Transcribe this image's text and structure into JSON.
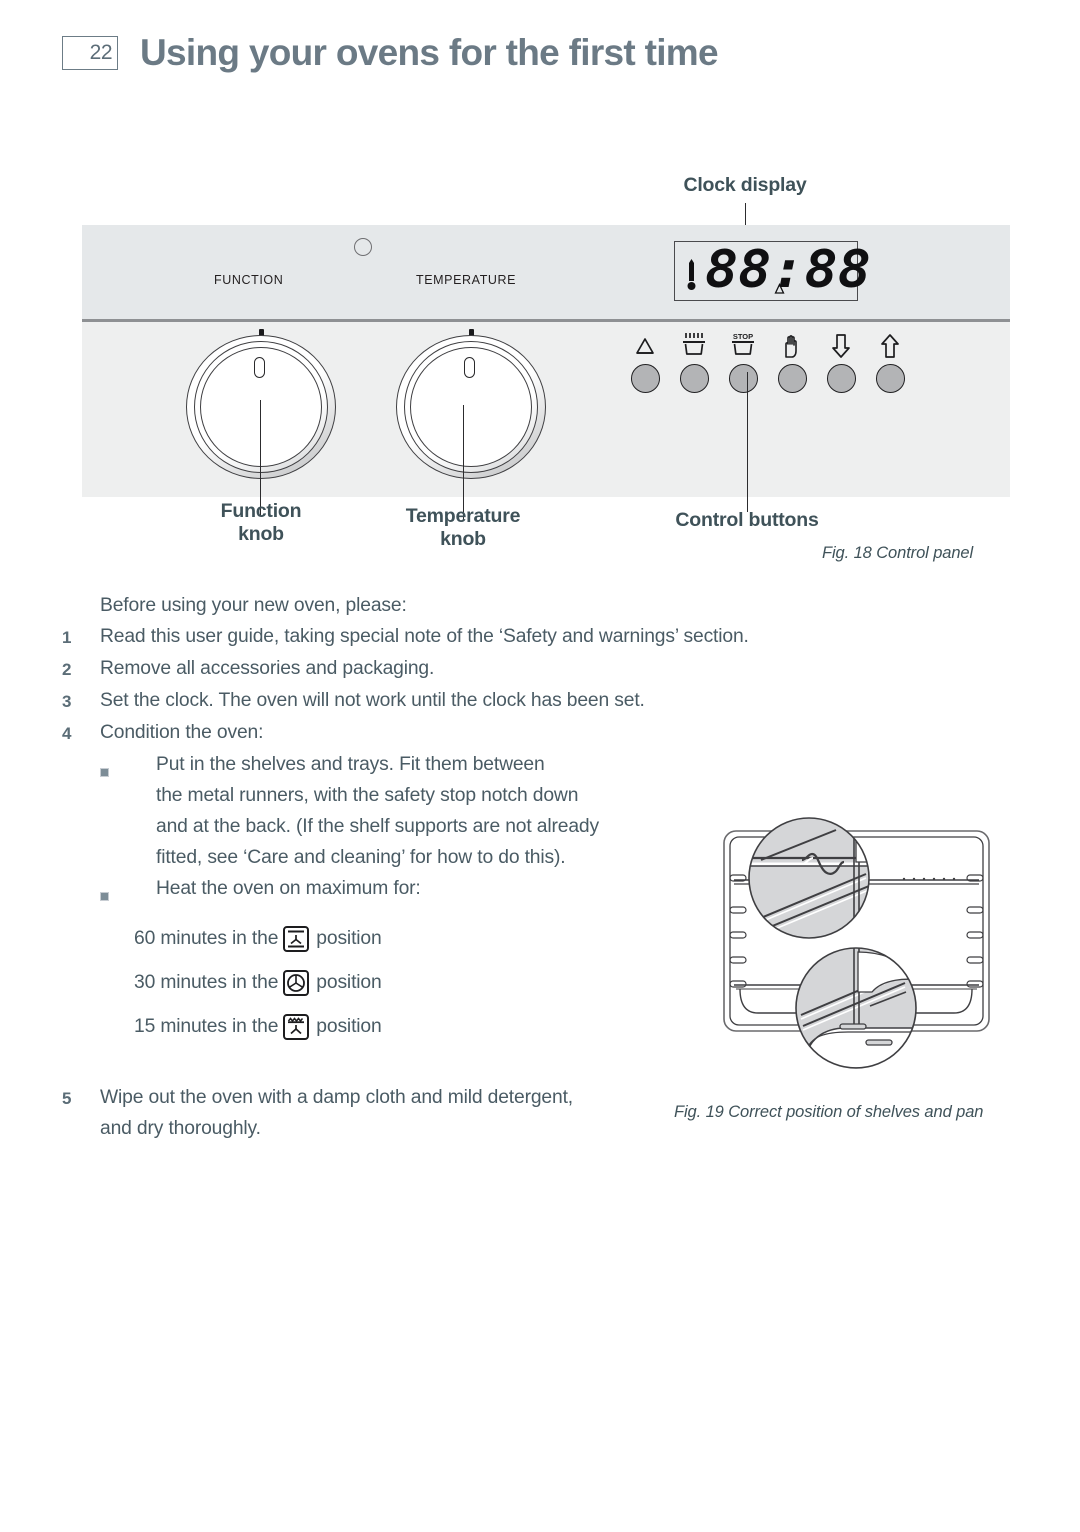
{
  "header": {
    "page_number": "22",
    "title": "Using your ovens for the first time"
  },
  "colors": {
    "heading": "#6b7a85",
    "body_text": "#4a5b64",
    "callout": "#3f5259",
    "panel_top_bg": "#e5e8ea",
    "panel_bottom_bg": "#eeefef",
    "panel_divider": "#8e9093",
    "button_fill": "#b3b4b6",
    "bullet_square": "#7d8d97"
  },
  "fig18": {
    "caption": "Fig. 18 Control panel",
    "panel_labels": {
      "function": "FUNCTION",
      "temperature": "TEMPERATURE"
    },
    "clock": {
      "display_value": "88:88",
      "thermometer_icon": "thermometer-icon",
      "bell_icon": "bell-small-icon"
    },
    "knobs": [
      {
        "name": "function-knob",
        "indicator": "0"
      },
      {
        "name": "temperature-knob",
        "indicator": "0"
      }
    ],
    "control_buttons": [
      {
        "icon": "bell-icon",
        "label": ""
      },
      {
        "icon": "cook-pot-heat-icon",
        "label": ""
      },
      {
        "icon": "stop-pot-icon",
        "label": "STOP"
      },
      {
        "icon": "hand-icon",
        "label": ""
      },
      {
        "icon": "arrow-down-icon",
        "label": ""
      },
      {
        "icon": "arrow-up-icon",
        "label": ""
      }
    ],
    "callouts": {
      "clock_display": "Clock display",
      "function_knob": "Function\nknob",
      "temperature_knob": "Temperature\nknob",
      "control_buttons": "Control buttons"
    },
    "indicator_light": "indicator-light-icon"
  },
  "fig19": {
    "caption": "Fig. 19 Correct position of shelves and pan",
    "illustration": "oven-interior-shelves-and-pan-diagram"
  },
  "content": {
    "intro": "Before using your new oven, please:",
    "steps": [
      {
        "num": "1",
        "text": "Read this user guide, taking special note of the ‘Safety and warnings’ section."
      },
      {
        "num": "2",
        "text": "Remove all accessories and packaging."
      },
      {
        "num": "3",
        "text": "Set the clock. The oven will not work until the clock has been set."
      },
      {
        "num": "4",
        "text": "Condition the oven:"
      }
    ],
    "sub_bullets": [
      {
        "bullet": "square-bullet",
        "lines": [
          "Put in the shelves and trays. Fit them between",
          "the metal runners, with the safety stop notch down",
          "and at the back. (If the shelf supports are not already",
          "fitted, see ‘Care and cleaning’ for how to do this)."
        ]
      },
      {
        "bullet": "square-bullet",
        "lines": [
          "Heat the oven on maximum for:"
        ]
      }
    ],
    "minutes": [
      {
        "before": "60 minutes in the",
        "icon": "fan-bake-icon",
        "after": "position"
      },
      {
        "before": "30 minutes in the",
        "icon": "fan-only-icon",
        "after": "position"
      },
      {
        "before": "15 minutes in the",
        "icon": "fan-grill-icon",
        "after": "position"
      }
    ],
    "last_step": {
      "num": "5",
      "lines": [
        "Wipe out the oven with a damp cloth and mild detergent,",
        "and dry thoroughly."
      ]
    }
  }
}
